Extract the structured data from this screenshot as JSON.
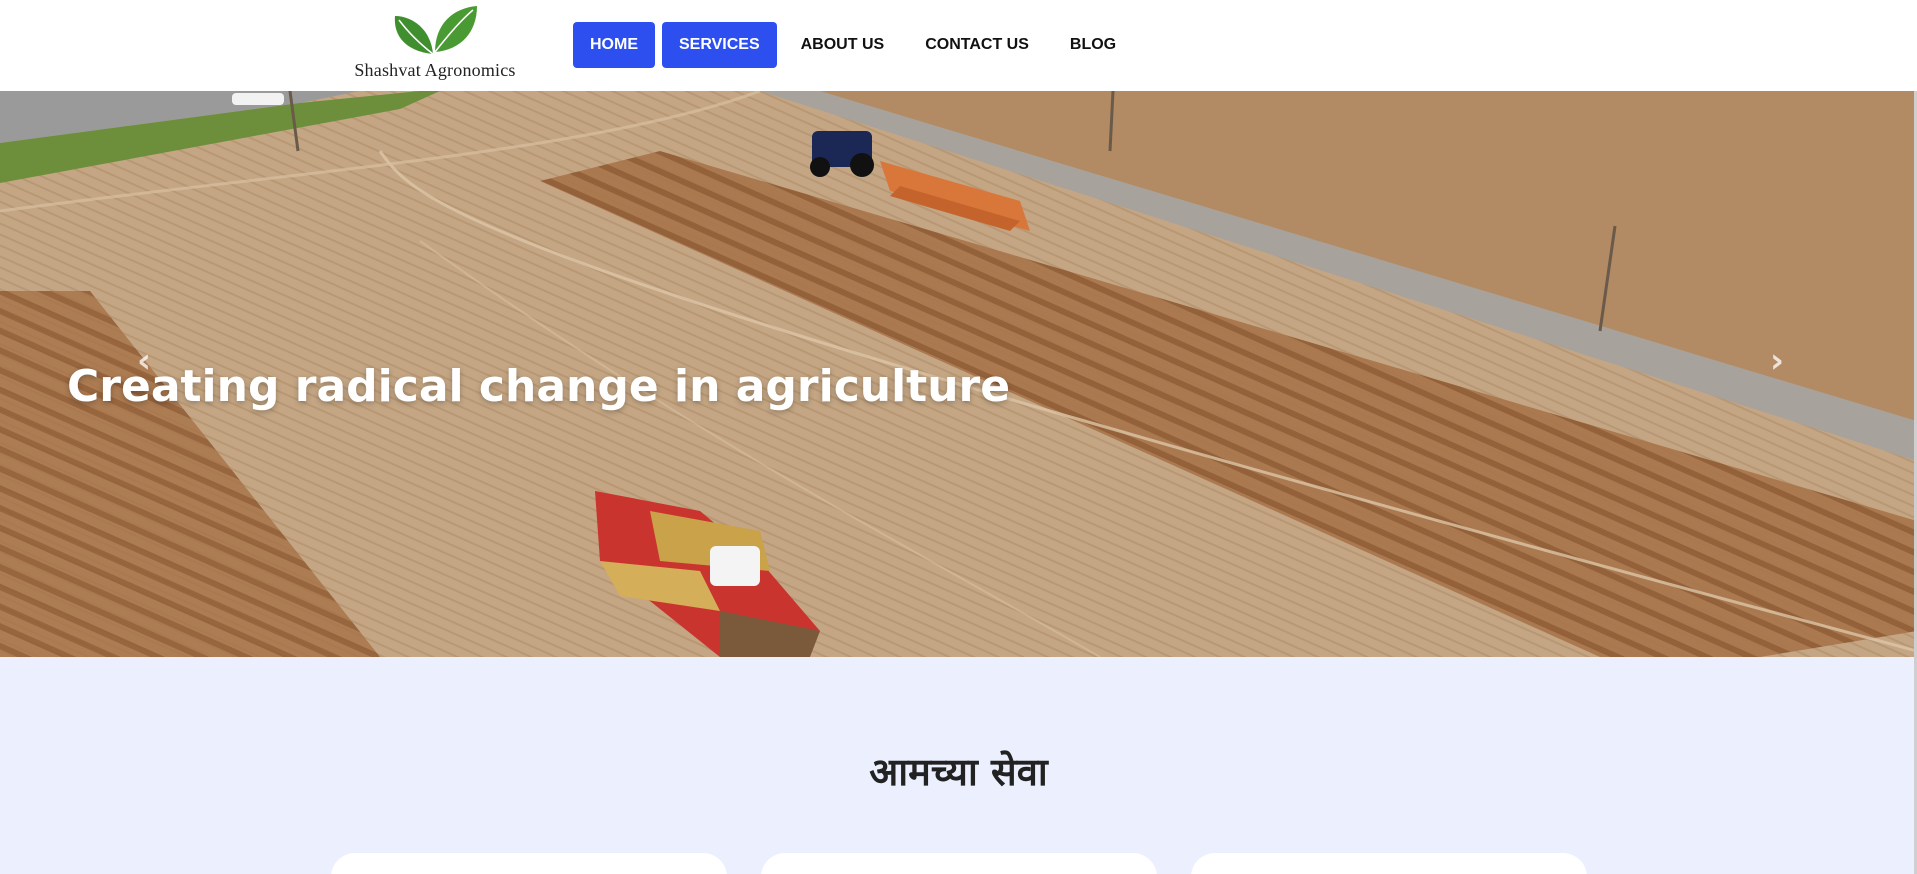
{
  "brand": {
    "name": "Shashvat Agronomics",
    "logo_icon": "twin-leaf-logo",
    "leaf_color": "#3f8f2f"
  },
  "nav": {
    "items": [
      {
        "label": "HOME",
        "active": true
      },
      {
        "label": "SERVICES",
        "active": true
      },
      {
        "label": "ABOUT US",
        "active": false
      },
      {
        "label": "CONTACT US",
        "active": false
      },
      {
        "label": "BLOG",
        "active": false
      }
    ],
    "active_color": "#2e4ff0"
  },
  "hero": {
    "title": "Creating radical change in agriculture",
    "prev_icon": "chevron-left-icon",
    "next_icon": "chevron-right-icon",
    "prev_glyph": "‹",
    "next_glyph": "›"
  },
  "services": {
    "title": "आमच्या सेवा",
    "background": "#ecf0fe",
    "card_count": 3
  }
}
